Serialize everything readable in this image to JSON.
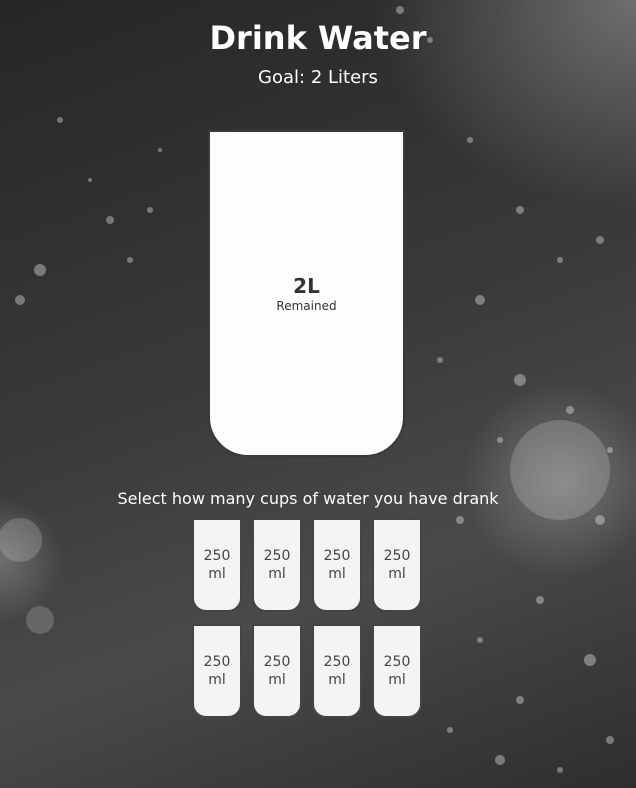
{
  "header": {
    "title": "Drink Water",
    "goal": "Goal: 2 Liters"
  },
  "big_cup": {
    "remained_value": "2L",
    "remained_label": "Remained"
  },
  "instruction": "Select how many cups of water you have drank",
  "cups": [
    {
      "amount": "250",
      "unit": "ml"
    },
    {
      "amount": "250",
      "unit": "ml"
    },
    {
      "amount": "250",
      "unit": "ml"
    },
    {
      "amount": "250",
      "unit": "ml"
    },
    {
      "amount": "250",
      "unit": "ml"
    },
    {
      "amount": "250",
      "unit": "ml"
    },
    {
      "amount": "250",
      "unit": "ml"
    },
    {
      "amount": "250",
      "unit": "ml"
    }
  ]
}
